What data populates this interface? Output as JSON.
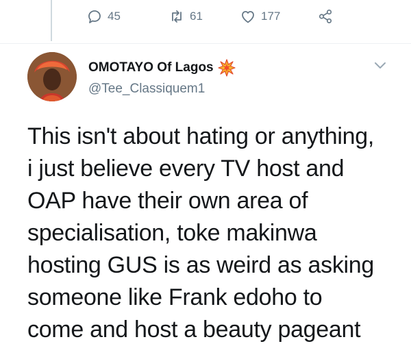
{
  "tweet_actions": {
    "reply_count": "45",
    "retweet_count": "61",
    "like_count": "177"
  },
  "author": {
    "display_name": "OMOTAYO Of Lagos",
    "handle": "@Tee_Classiquem1",
    "badge_icon": "collision-emoji"
  },
  "tweet": {
    "lines": [
      "This isn't about hating or anything,",
      "i just believe every TV host and",
      "OAP have their own area of",
      "specialisation, toke makinwa",
      "hosting GUS is as weird as asking",
      "someone like Frank edoho to",
      "come and host a beauty pageant"
    ]
  },
  "colors": {
    "text": "#14171a",
    "muted": "#657786",
    "thread_line": "#cfd9de"
  }
}
